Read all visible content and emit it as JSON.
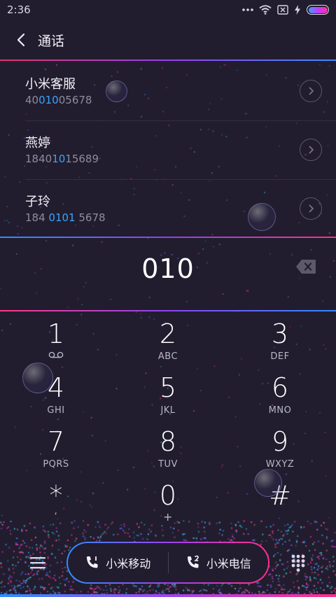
{
  "status_bar": {
    "time": "2:36",
    "battery_level": 1.0
  },
  "header": {
    "title": "通话"
  },
  "contacts": [
    {
      "name": "小米客服",
      "number_before": "40",
      "number_match": "010",
      "number_after": "05678"
    },
    {
      "name": "燕婷",
      "number_before": "1840",
      "number_match": "10",
      "number_after": "15689"
    },
    {
      "name": "子玲",
      "number_before": "184 ",
      "number_match": "0101",
      "number_after": " 5678"
    }
  ],
  "dialed_number": "010",
  "keypad": [
    {
      "digit": "1",
      "letters": ""
    },
    {
      "digit": "2",
      "letters": "ABC"
    },
    {
      "digit": "3",
      "letters": "DEF"
    },
    {
      "digit": "4",
      "letters": "GHI"
    },
    {
      "digit": "5",
      "letters": "JKL"
    },
    {
      "digit": "6",
      "letters": "MNO"
    },
    {
      "digit": "7",
      "letters": "PQRS"
    },
    {
      "digit": "8",
      "letters": "TUV"
    },
    {
      "digit": "9",
      "letters": "WXYZ"
    },
    {
      "digit": "*",
      "letters": ","
    },
    {
      "digit": "0",
      "letters": "+"
    },
    {
      "digit": "#",
      "letters": ""
    }
  ],
  "call_buttons": {
    "sim1_label": "小米移动",
    "sim2_label": "小米电信"
  },
  "colors": {
    "background": "#211d2e",
    "accent_blue": "#3aa3ff",
    "accent_purple": "#9d44f0",
    "accent_pink": "#ff2f8a"
  },
  "icons": [
    "wifi-icon",
    "sim-blocked-icon",
    "charging-icon",
    "back-icon",
    "chevron-right-icon",
    "backspace-icon",
    "voicemail-icon",
    "menu-icon",
    "phone-sim1-icon",
    "phone-sim2-icon",
    "dialpad-icon"
  ]
}
